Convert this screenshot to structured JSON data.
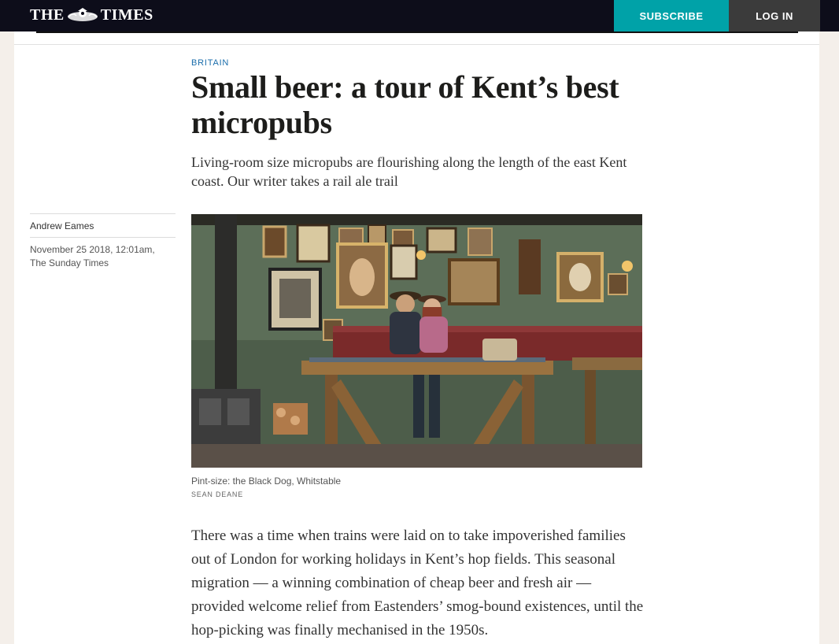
{
  "header": {
    "masthead_left": "THE",
    "masthead_right": "TIMES",
    "subscribe_label": "SUBSCRIBE",
    "login_label": "LOG IN",
    "colors": {
      "bar": "#0d0d1a",
      "subscribe": "#00a2a8",
      "login": "#3b3b3b"
    }
  },
  "article": {
    "section": "BRITAIN",
    "headline": "Small beer: a tour of Kent’s best micropubs",
    "standfirst": "Living-room size micropubs are flourishing along the length of the east Kent coast. Our writer takes a rail ale trail",
    "author": "Andrew Eames",
    "date": "November 25 2018, 12:01am,",
    "publication": "The Sunday Times",
    "image": {
      "caption": "Pint-size: the Black Dog, Whitstable",
      "credit": "SEAN DEANE"
    },
    "body": "There was a time when trains were laid on to take impoverished families out of London for working holidays in Kent’s hop fields. This seasonal migration — a winning combination of cheap beer and fresh air — provided welcome relief from Eastenders’ smog-bound existences, until the hop-picking was finally mechanised in the 1950s."
  }
}
